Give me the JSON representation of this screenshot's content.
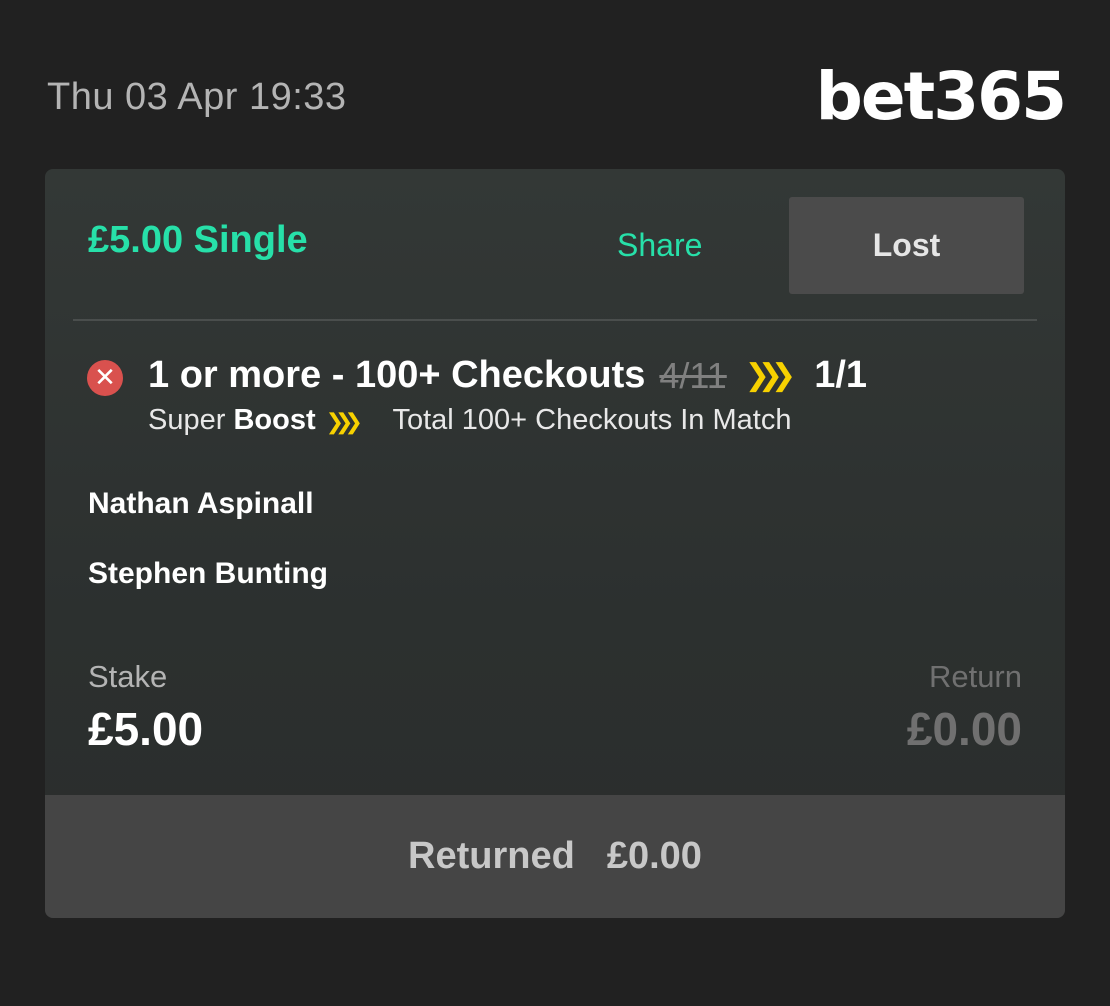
{
  "header": {
    "timestamp": "Thu 03 Apr 19:33",
    "logo_text": "bet365"
  },
  "bet": {
    "title": "£5.00 Single",
    "share_label": "Share",
    "status_label": "Lost",
    "selection": {
      "status_icon": "x-circle-icon",
      "name": "1 or more - 100+ Checkouts",
      "old_odds": "4/11",
      "boost_icon": "chevron-triple-right-icon",
      "new_odds": "1/1",
      "subline_prefix": "Super",
      "subline_boost": "Boost",
      "market": "Total 100+ Checkouts In Match"
    },
    "participants": [
      "Nathan Aspinall",
      "Stephen Bunting"
    ],
    "stake_label": "Stake",
    "stake_value": "£5.00",
    "return_label": "Return",
    "return_value": "£0.00",
    "returned_label": "Returned",
    "returned_value": "£0.00"
  },
  "colors": {
    "background": "#212121",
    "card": "#333836",
    "accent_green": "#27e0a9",
    "boost_yellow": "#f7d100",
    "lost_red": "#d9514e",
    "status_button": "#4b4b4b",
    "footer": "#454545"
  }
}
